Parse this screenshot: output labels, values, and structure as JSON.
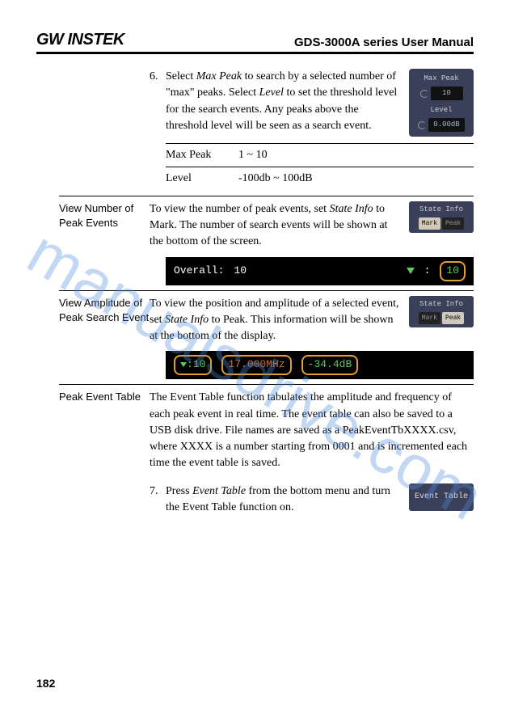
{
  "header": {
    "brand": "GW INSTEK",
    "title": "GDS-3000A series User Manual"
  },
  "step6": {
    "num": "6.",
    "text_parts": [
      "Select ",
      "Max Peak",
      " to search by a selected number of \"max\" peaks. Select ",
      "Level",
      " to set the threshold level for the search events. Any peaks above the threshold level will be seen as a search event."
    ],
    "panel": {
      "maxpeak_label": "Max Peak",
      "maxpeak_value": "10",
      "level_label": "Level",
      "level_value": "0.00dB"
    },
    "specs": [
      {
        "k": "Max Peak",
        "v": "1 ~ 10"
      },
      {
        "k": "Level",
        "v": "-100db ~ 100dB"
      }
    ]
  },
  "view_number": {
    "label": "View Number of Peak Events",
    "text_parts": [
      "To view the number of peak events, set ",
      "State Info",
      " to Mark. The number of search events will be shown at the bottom of the screen."
    ],
    "panel": {
      "title": "State Info",
      "mark": "Mark",
      "peak": "Peak",
      "active": "mark"
    },
    "bar": {
      "overall_label": "Overall:",
      "overall_value": "10",
      "peak_value": "10"
    }
  },
  "view_amp": {
    "label": "View Amplitude of Peak Search Event",
    "text_parts": [
      "To view the position and amplitude of a selected event, set ",
      "State Info",
      " to Peak. This information will be shown at the bottom of the display."
    ],
    "panel": {
      "title": "State Info",
      "mark": "Mark",
      "peak": "Peak",
      "active": "peak"
    },
    "bar": {
      "idx": "10",
      "freq": "17.000MHz",
      "db": "-34.4dB"
    }
  },
  "peak_table": {
    "label": "Peak Event Table",
    "text": "The Event Table function tabulates the amplitude and frequency of each peak event in real time. The event table can also be saved to a USB disk drive. File names are saved as a PeakEventTbXXXX.csv, where XXXX is a number starting from 0001 and is incremented each time the event table is saved."
  },
  "step7": {
    "num": "7.",
    "text_parts": [
      "Press ",
      "Event Table",
      " from the bottom menu and turn the Event Table function on."
    ],
    "btn": "Event Table"
  },
  "page": "182",
  "watermark": "manualsdrive.com"
}
